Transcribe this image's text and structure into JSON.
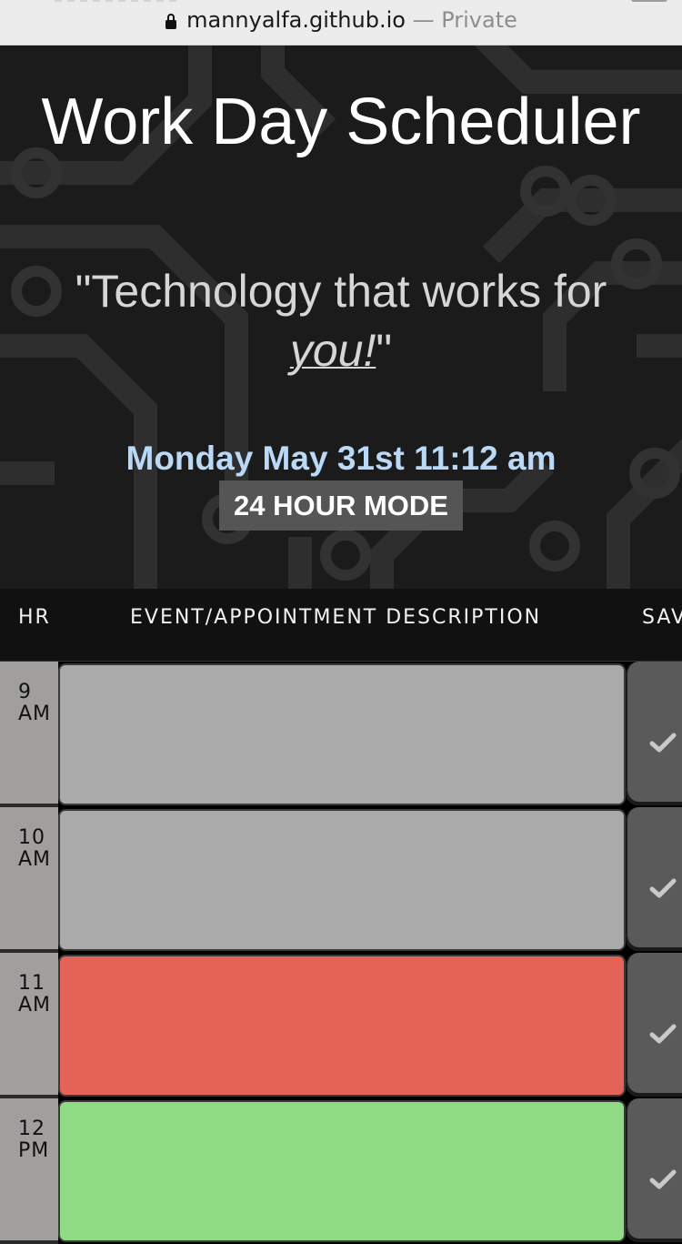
{
  "browser": {
    "domain": "mannyalfa.github.io",
    "separator": " — ",
    "mode": "Private"
  },
  "header": {
    "title": "Work Day Scheduler",
    "tagline_before": "\"Technology that works for ",
    "tagline_emphasis": "you!",
    "tagline_after": "\"",
    "current_datetime": "Monday May 31st 11:12 am",
    "mode_button": "24 HOUR MODE"
  },
  "table": {
    "columns": [
      "HR",
      "EVENT/APPOINTMENT DESCRIPTION",
      "SAV"
    ],
    "rows": [
      {
        "hour": "9",
        "period": "AM",
        "status": "past",
        "description": ""
      },
      {
        "hour": "10",
        "period": "AM",
        "status": "past",
        "description": ""
      },
      {
        "hour": "11",
        "period": "AM",
        "status": "present",
        "description": ""
      },
      {
        "hour": "12",
        "period": "PM",
        "status": "future",
        "description": ""
      }
    ]
  },
  "colors": {
    "past": "#aaaaaa",
    "present": "#e46256",
    "future": "#90dc84",
    "date_text": "#b9d9f7",
    "mode_button_bg": "#555555"
  },
  "icons": {
    "save": "check-icon",
    "url_lock": "lock-icon"
  }
}
